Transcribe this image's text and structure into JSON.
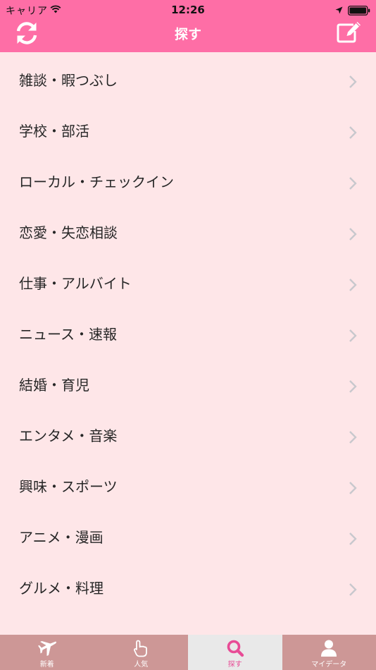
{
  "status_bar": {
    "carrier": "キャリア",
    "time": "12:26"
  },
  "nav": {
    "title": "探す"
  },
  "categories": [
    {
      "label": "雑談・暇つぶし"
    },
    {
      "label": "学校・部活"
    },
    {
      "label": "ローカル・チェックイン"
    },
    {
      "label": "恋愛・失恋相談"
    },
    {
      "label": "仕事・アルバイト"
    },
    {
      "label": "ニュース・速報"
    },
    {
      "label": "結婚・育児"
    },
    {
      "label": "エンタメ・音楽"
    },
    {
      "label": "興味・スポーツ"
    },
    {
      "label": "アニメ・漫画"
    },
    {
      "label": "グルメ・料理"
    }
  ],
  "tab_bar": {
    "tabs": [
      {
        "label": "新着",
        "icon": "airplane-icon"
      },
      {
        "label": "人気",
        "icon": "hand-pointer-icon"
      },
      {
        "label": "探す",
        "icon": "search-icon",
        "active": true
      },
      {
        "label": "マイデータ",
        "icon": "user-icon"
      }
    ]
  },
  "colors": {
    "header": "#fe6ea6",
    "background": "#fee6e8",
    "tab_bar": "#cd9796",
    "tab_active_bg": "#e9e9e9",
    "tab_active_accent": "#e84c96",
    "chevron": "#c8c8cd"
  }
}
